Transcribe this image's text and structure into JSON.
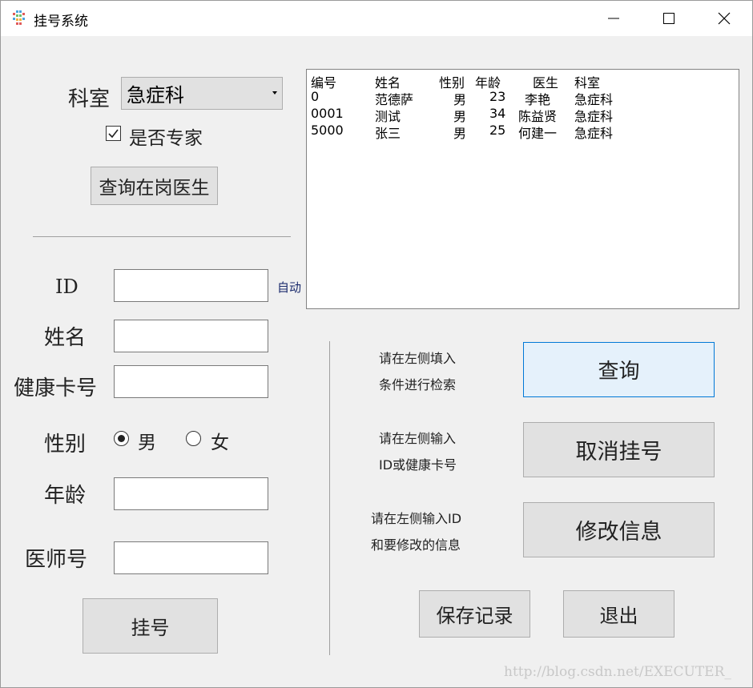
{
  "window": {
    "title": "挂号系统",
    "icons": {
      "app": "app-icon",
      "minimize": "minimize-icon",
      "maximize": "maximize-icon",
      "close": "close-icon"
    }
  },
  "filter": {
    "dept_label": "科室",
    "dept_selected": "急症科",
    "expert_label": "是否专家",
    "expert_checked": true,
    "query_doctors_button": "查询在岗医生"
  },
  "form": {
    "id_label": "ID",
    "id_hint": "自动",
    "name_label": "姓名",
    "card_label": "健康卡号",
    "gender_label": "性别",
    "gender_options": [
      "男",
      "女"
    ],
    "gender_selected": "男",
    "age_label": "年龄",
    "doctor_no_label": "医师号",
    "register_button": "挂号"
  },
  "records": {
    "columns": [
      "编号",
      "姓名",
      "性别",
      "年龄",
      "医生",
      "科室"
    ],
    "rows": [
      [
        "0",
        "范德萨",
        "男",
        "23",
        "李艳",
        "急症科"
      ],
      [
        "0001",
        "测试",
        "男",
        "34",
        "陈益贤",
        "急症科"
      ],
      [
        "5000",
        "张三",
        "男",
        "25",
        "何建一",
        "急症科"
      ]
    ]
  },
  "actions": {
    "query_hint": [
      "请在左侧填入",
      "条件进行检索"
    ],
    "query_button": "查询",
    "cancel_hint": [
      "请在左侧输入",
      "ID或健康卡号"
    ],
    "cancel_button": "取消挂号",
    "modify_hint": [
      "请在左侧输入ID",
      "和要修改的信息"
    ],
    "modify_button": "修改信息",
    "save_button": "保存记录",
    "exit_button": "退出"
  },
  "watermark": "http://blog.csdn.net/EXECUTER_"
}
